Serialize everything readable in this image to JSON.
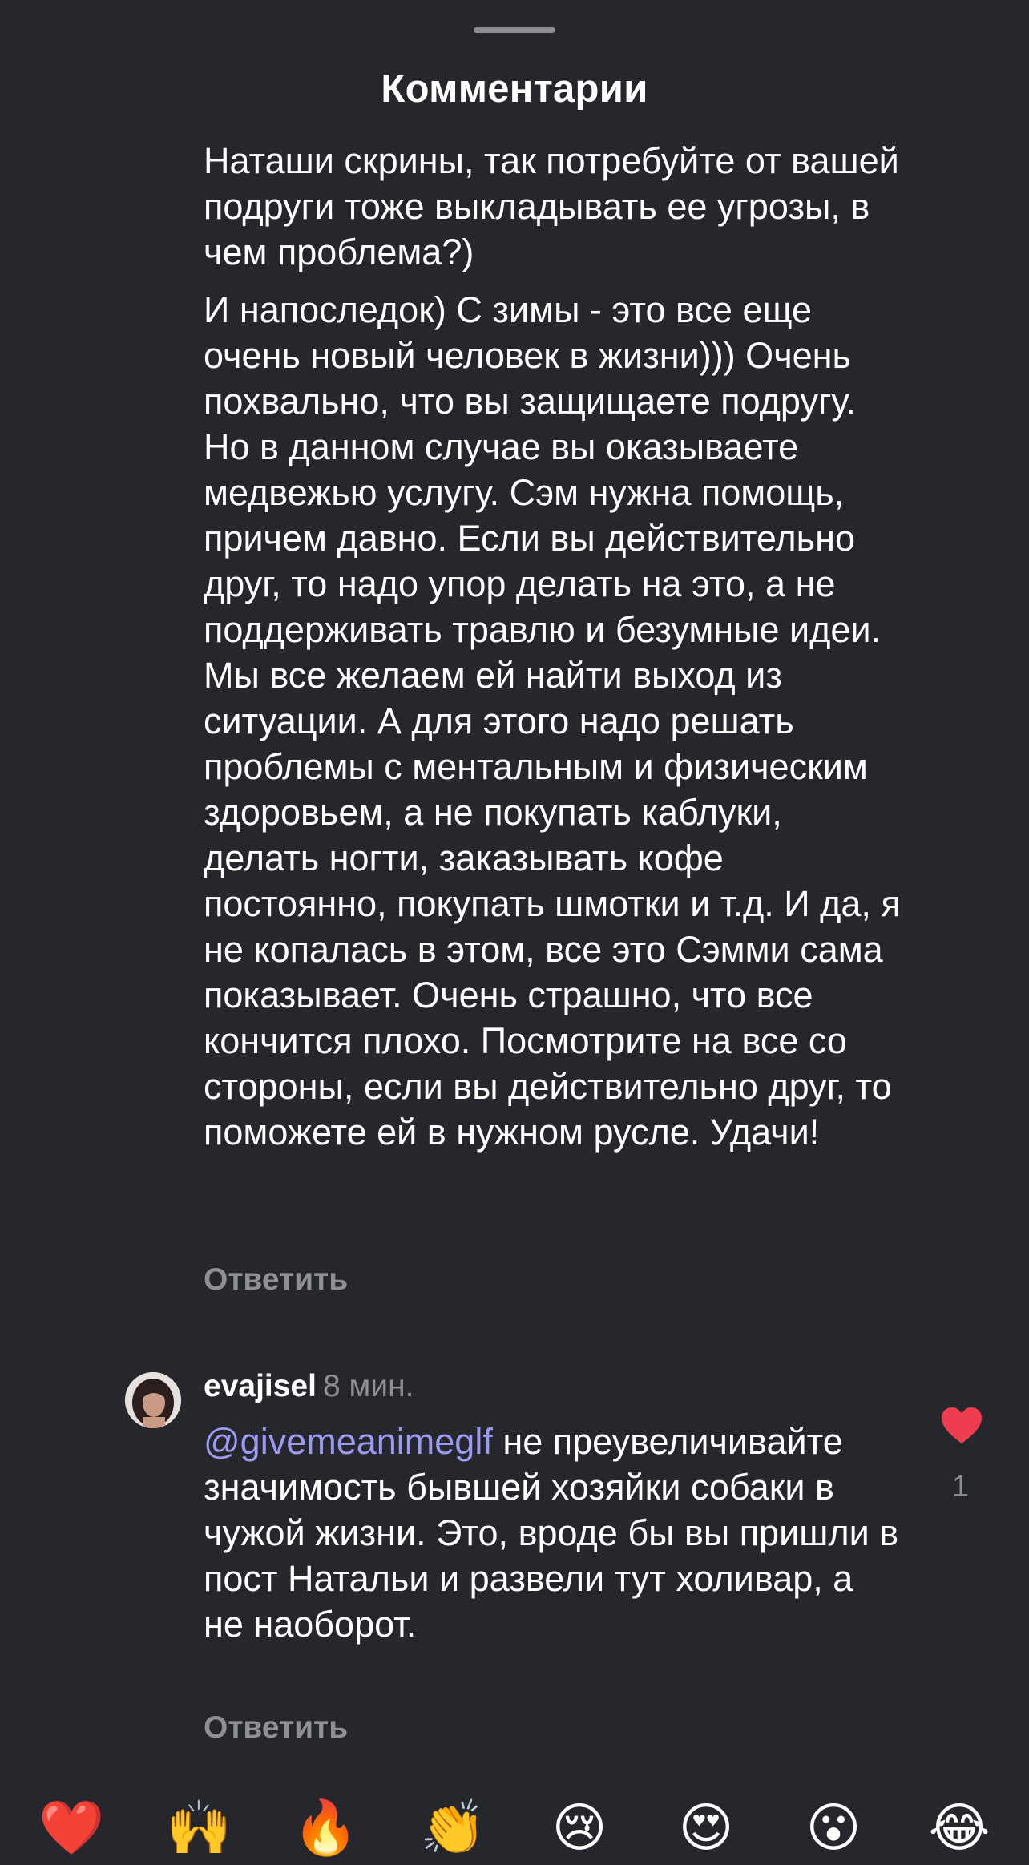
{
  "header": {
    "title": "Комментарии"
  },
  "comment1": {
    "paragraph1": "Наташи скрины, так потребуйте от вашей подруги тоже выкладывать ее угрозы, в чем проблема?)",
    "paragraph2": "И напоследок) С зимы - это все еще очень новый человек в жизни))) Очень похвально, что вы защищаете подругу. Но в данном случае вы оказываете медвежью услугу. Сэм нужна помощь, причем давно. Если вы действительно друг, то надо упор делать на это, а не поддерживать травлю и безумные идеи. Мы все желаем ей найти выход из ситуации. А для этого надо решать проблемы с ментальным и физическим здоровьем, а не покупать каблуки, делать ногти, заказывать кофе постоянно, покупать шмотки и т.д. И да, я не копалась в этом, все это Сэмми сама показывает. Очень страшно, что все кончится плохо. Посмотрите на все со стороны, если вы действительно друг, то поможете ей в нужном русле. Удачи!",
    "reply_label": "Ответить"
  },
  "comment2": {
    "username": "evajisel",
    "time": "8 мин.",
    "mention": "@givemeanimeglf",
    "text": " не преувеличивайте значимость бывшей хозяйки собаки в чужой жизни. Это, вроде бы вы пришли в пост Натальи и развели тут холивар, а не наоборот.",
    "likes": "1",
    "reply_label": "Ответить",
    "liked": true,
    "like_color": "#ee3d4f"
  },
  "reactions": [
    {
      "icon": "red-heart",
      "glyph": "❤️"
    },
    {
      "icon": "raising-hands",
      "glyph": "🙌"
    },
    {
      "icon": "fire",
      "glyph": "🔥"
    },
    {
      "icon": "clapping-hands",
      "glyph": "👏"
    },
    {
      "icon": "crying-face",
      "glyph": "😢"
    },
    {
      "icon": "heart-eyes",
      "glyph": "😍"
    },
    {
      "icon": "surprised-face",
      "glyph": "😮"
    },
    {
      "icon": "tears-of-joy",
      "glyph": "😂"
    }
  ]
}
